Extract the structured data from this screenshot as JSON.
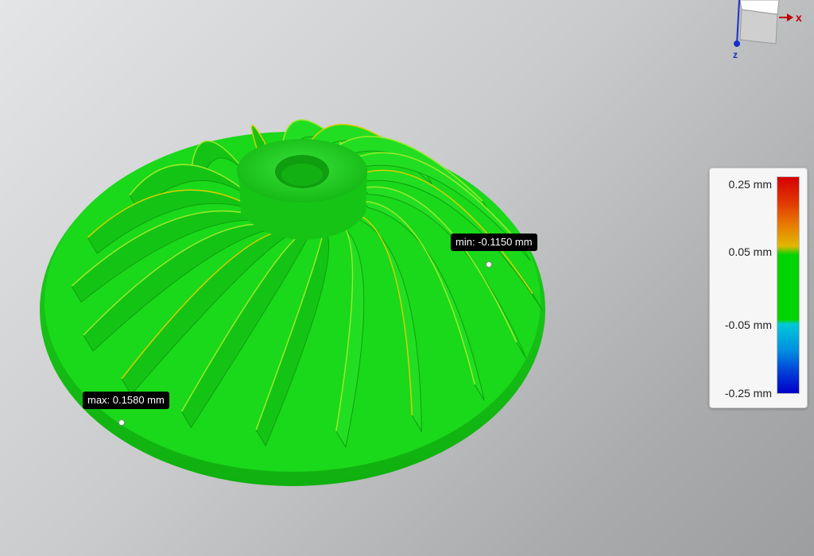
{
  "viewport": {
    "model": "impeller",
    "annotations": {
      "max": {
        "label": "max:",
        "value": "0.1580 mm"
      },
      "min": {
        "label": "min:",
        "value": "-0.1150 mm"
      }
    }
  },
  "legend": {
    "labels": [
      "0.25 mm",
      "0.05 mm",
      "-0.05 mm",
      "-0.25 mm"
    ],
    "colors": {
      "high": "#d40000",
      "upper_mid": "#e0b800",
      "in_tolerance": "#00d400",
      "lower_mid": "#00b4e0",
      "low": "#0000c8"
    }
  },
  "view_triad": {
    "x_label": "x",
    "z_label": "z",
    "colors": {
      "x": "#c00000",
      "z": "#1a2fc8"
    }
  }
}
